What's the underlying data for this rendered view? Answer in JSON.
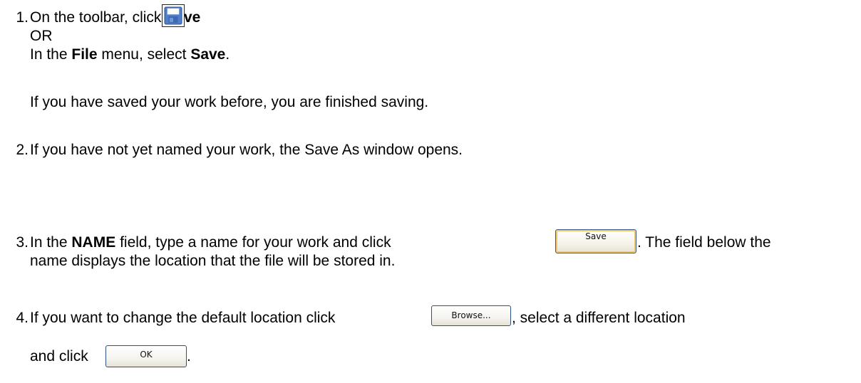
{
  "steps": [
    {
      "number": "1.",
      "line1_prefix": "On the toolbar, click ",
      "line1_bold": "Save",
      "or_text": "OR",
      "line3_prefix": "In the ",
      "line3_bold1": "File",
      "line3_middle": " menu, select ",
      "line3_bold2": "Save",
      "line3_suffix": ".",
      "note": "If you have saved your work before, you are finished saving.",
      "icon": "floppy-disk-icon"
    },
    {
      "number": "2.",
      "text": "If you have not yet named your work, the Save As window opens."
    },
    {
      "number": "3.",
      "prefix": "In the ",
      "bold": "NAME",
      "middle": " field, type a name for your work and click ",
      "button_label": "Save",
      "suffix": ". The field below the",
      "line2": "name displays the location that the file will be stored in."
    },
    {
      "number": "4.",
      "prefix": "If you want to change the default location click ",
      "button_label": "Browse...",
      "suffix": ", select a different location",
      "line2_prefix": "and click ",
      "ok_label": "OK",
      "line2_suffix": "."
    }
  ],
  "colors": {
    "save_button_highlight": "#f2c768",
    "button_border": "#2f4f80",
    "icon_blue": "#4f7fc8"
  }
}
